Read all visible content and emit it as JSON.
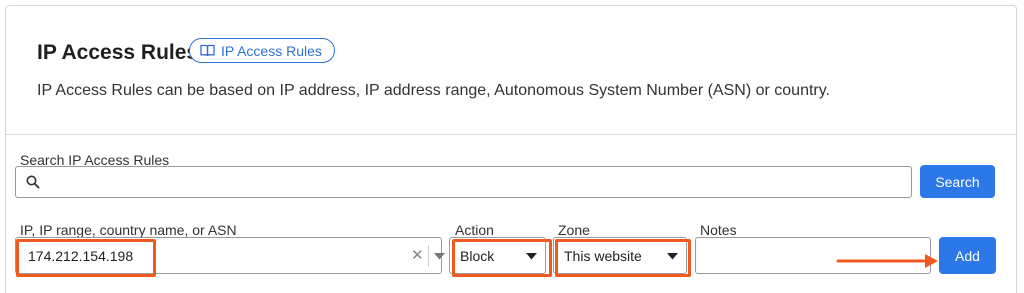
{
  "header": {
    "title": "IP Access Rules",
    "doc_link_label": "IP Access Rules",
    "description": "IP Access Rules can be based on IP address, IP address range, Autonomous System Number (ASN) or country."
  },
  "search": {
    "label": "Search IP Access Rules",
    "value": "",
    "button_label": "Search",
    "icon": "search-icon"
  },
  "form": {
    "ip_label": "IP, IP range, country name, or ASN",
    "ip_value": "174.212.154.198",
    "action_label": "Action",
    "action_value": "Block",
    "zone_label": "Zone",
    "zone_value": "This website",
    "notes_label": "Notes",
    "notes_value": "",
    "add_label": "Add"
  },
  "colors": {
    "primary_button": "#2d78e8",
    "link": "#2f6fd6",
    "highlight": "#ef5b1f"
  }
}
